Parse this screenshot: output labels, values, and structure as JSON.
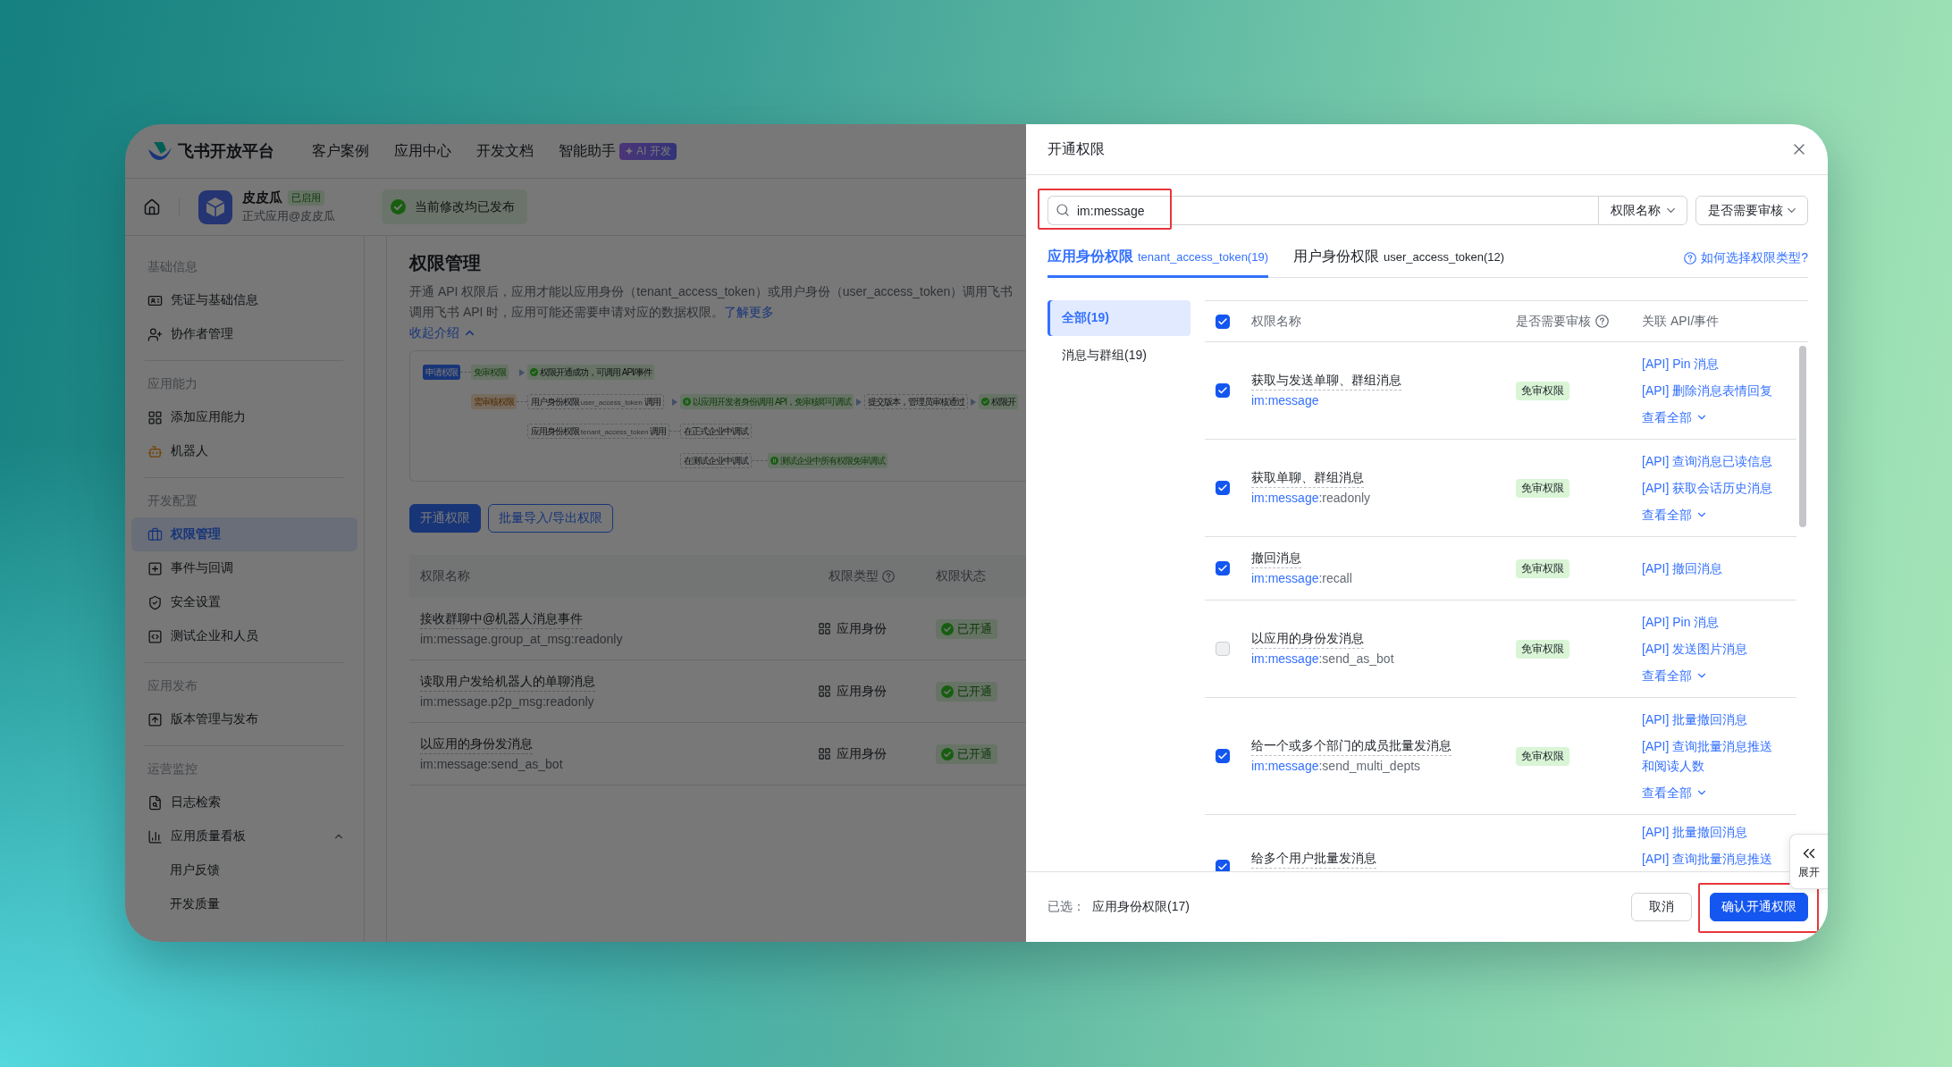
{
  "header": {
    "logo": "飞书开放平台",
    "nav": [
      {
        "label": "客户案例"
      },
      {
        "label": "应用中心"
      },
      {
        "label": "开发文档"
      },
      {
        "label": "智能助手",
        "badge": "AI 开发"
      }
    ]
  },
  "app_bar": {
    "name": "皮皮瓜",
    "status": "已启用",
    "subtitle": "正式应用@皮皮瓜",
    "notice": "当前修改均已发布"
  },
  "sidebar": {
    "sections": [
      {
        "title": "基础信息",
        "items": [
          {
            "label": "凭证与基础信息",
            "selected": false
          },
          {
            "label": "协作者管理",
            "selected": false
          }
        ]
      },
      {
        "title": "应用能力",
        "items": [
          {
            "label": "添加应用能力",
            "selected": false
          },
          {
            "label": "机器人",
            "selected": false
          }
        ]
      },
      {
        "title": "开发配置",
        "items": [
          {
            "label": "权限管理",
            "selected": true
          },
          {
            "label": "事件与回调",
            "selected": false
          },
          {
            "label": "安全设置",
            "selected": false
          },
          {
            "label": "测试企业和人员",
            "selected": false
          }
        ]
      },
      {
        "title": "应用发布",
        "items": [
          {
            "label": "版本管理与发布",
            "selected": false
          }
        ]
      },
      {
        "title": "运营监控",
        "items": [
          {
            "label": "日志检索",
            "selected": false
          },
          {
            "label": "应用质量看板",
            "selected": false,
            "expanded": true,
            "children": [
              {
                "label": "用户反馈",
                "selected": false
              },
              {
                "label": "开发质量",
                "selected": false
              }
            ]
          }
        ]
      }
    ]
  },
  "page": {
    "title": "权限管理",
    "intro": [
      "开通 API 权限后，应用才能以应用身份（tenant_access_token）或用户身份（user_access_token）调用飞书",
      "调用飞书 API 时，应用可能还需要申请对应的数据权限。"
    ],
    "learn_more": "了解更多",
    "collapse": "收起介绍",
    "flow_diagram": {
      "lanes": [
        {
          "steps": [
            {
              "kind": "apply",
              "label": "申请权限"
            },
            {
              "kind": "line"
            },
            {
              "kind": "free",
              "label": "免审权限"
            },
            {
              "kind": "arrow"
            },
            {
              "kind": "success",
              "label": "权限开通成功，可调用 API/事件"
            }
          ]
        },
        {
          "steps": [
            {
              "kind": "review",
              "label": "需审核权限"
            },
            {
              "kind": "line"
            },
            {
              "kind": "step",
              "label": "用户身份权限",
              "token": "user_access_token",
              "suffix": "调用"
            },
            {
              "kind": "arrow"
            },
            {
              "kind": "debug",
              "label": "以应用开发者身份调用 API，免审核即可调试"
            },
            {
              "kind": "arrow"
            },
            {
              "kind": "step",
              "label": "提交版本，管理员审核通过"
            },
            {
              "kind": "arrow"
            },
            {
              "kind": "success",
              "label": "权限开"
            }
          ]
        },
        {
          "steps": [
            {
              "kind": "step",
              "label": "应用身份权限",
              "token": "tenant_access_token",
              "suffix": "调用"
            },
            {
              "kind": "line"
            },
            {
              "kind": "step",
              "label": "在正式企业中调试"
            }
          ]
        },
        {
          "steps": [
            {
              "kind": "step",
              "label": "在测试企业中调试"
            },
            {
              "kind": "line"
            },
            {
              "kind": "debug",
              "label": "测试企业中所有权限免审调试"
            }
          ]
        }
      ]
    },
    "buttons": [
      {
        "label": "开通权限",
        "kind": "primary"
      },
      {
        "label": "批量导入/导出权限",
        "kind": "outline"
      }
    ],
    "table": {
      "columns": [
        {
          "label": "权限名称",
          "help": false
        },
        {
          "label": "权限类型",
          "help": true
        },
        {
          "label": "权限状态",
          "help": false
        }
      ],
      "rows": [
        {
          "name": "接收群聊中@机器人消息事件",
          "code": "im:message.group_at_msg:readonly",
          "type": "应用身份",
          "status": "已开通"
        },
        {
          "name": "读取用户发给机器人的单聊消息",
          "code": "im:message.p2p_msg:readonly",
          "type": "应用身份",
          "status": "已开通"
        },
        {
          "name": "以应用的身份发消息",
          "code": "im:message:send_as_bot",
          "type": "应用身份",
          "status": "已开通"
        }
      ]
    }
  },
  "drawer": {
    "title": "开通权限",
    "search": {
      "value": "im:message",
      "highlighted": true
    },
    "filters": [
      {
        "label": "权限名称"
      },
      {
        "label": "是否需要审核"
      }
    ],
    "tabs": [
      {
        "label": "应用身份权限",
        "token": "tenant_access_token(19)",
        "selected": true
      },
      {
        "label": "用户身份权限",
        "token": "user_access_token(12)",
        "selected": false
      }
    ],
    "help_link": "如何选择权限类型?",
    "categories": [
      {
        "label": "全部(19)",
        "selected": true
      },
      {
        "label": "消息与群组(19)",
        "selected": false
      }
    ],
    "table": {
      "all_checked": true,
      "columns": [
        {
          "label": "权限名称",
          "help": false
        },
        {
          "label": "是否需要审核",
          "help": true
        },
        {
          "label": "关联 API/事件",
          "help": false
        }
      ],
      "rows": [
        {
          "checked": true,
          "name": "获取与发送单聊、群组消息",
          "scope": "im:message",
          "badge": "免审权限",
          "apis": [
            "[API] Pin 消息",
            "[API] 删除消息表情回复"
          ],
          "view_all": "查看全部"
        },
        {
          "checked": true,
          "name": "获取单聊、群组消息",
          "scope": "im:message",
          "scope_suffix": ":readonly",
          "badge": "免审权限",
          "apis": [
            "[API] 查询消息已读信息",
            "[API] 获取会话历史消息"
          ],
          "view_all": "查看全部"
        },
        {
          "checked": true,
          "name": "撤回消息",
          "scope": "im:message",
          "scope_suffix": ":recall",
          "badge": "免审权限",
          "apis": [
            "[API] 撤回消息"
          ]
        },
        {
          "checked": false,
          "name": "以应用的身份发消息",
          "scope": "im:message",
          "scope_suffix": ":send_as_bot",
          "badge": "免审权限",
          "apis": [
            "[API] Pin 消息",
            "[API] 发送图片消息"
          ],
          "view_all": "查看全部"
        },
        {
          "checked": true,
          "name": "给一个或多个部门的成员批量发消息",
          "scope": "im:message",
          "scope_suffix": ":send_multi_depts",
          "badge": "免审权限",
          "apis": [
            "[API] 批量撤回消息",
            "[API] 查询批量消息推送和阅读人数"
          ],
          "view_all": "查看全部"
        },
        {
          "checked": true,
          "name": "给多个用户批量发消息",
          "apis": [
            "[API] 批量撤回消息",
            "[API] 查询批量消息推送"
          ]
        }
      ]
    },
    "footer": {
      "label": "已选：",
      "value": "应用身份权限(17)",
      "buttons": [
        {
          "label": "取消",
          "kind": "secondary",
          "highlighted": false
        },
        {
          "label": "确认开通权限",
          "kind": "primary",
          "highlighted": true
        }
      ]
    },
    "expand_tab": {
      "label": "展开"
    }
  }
}
